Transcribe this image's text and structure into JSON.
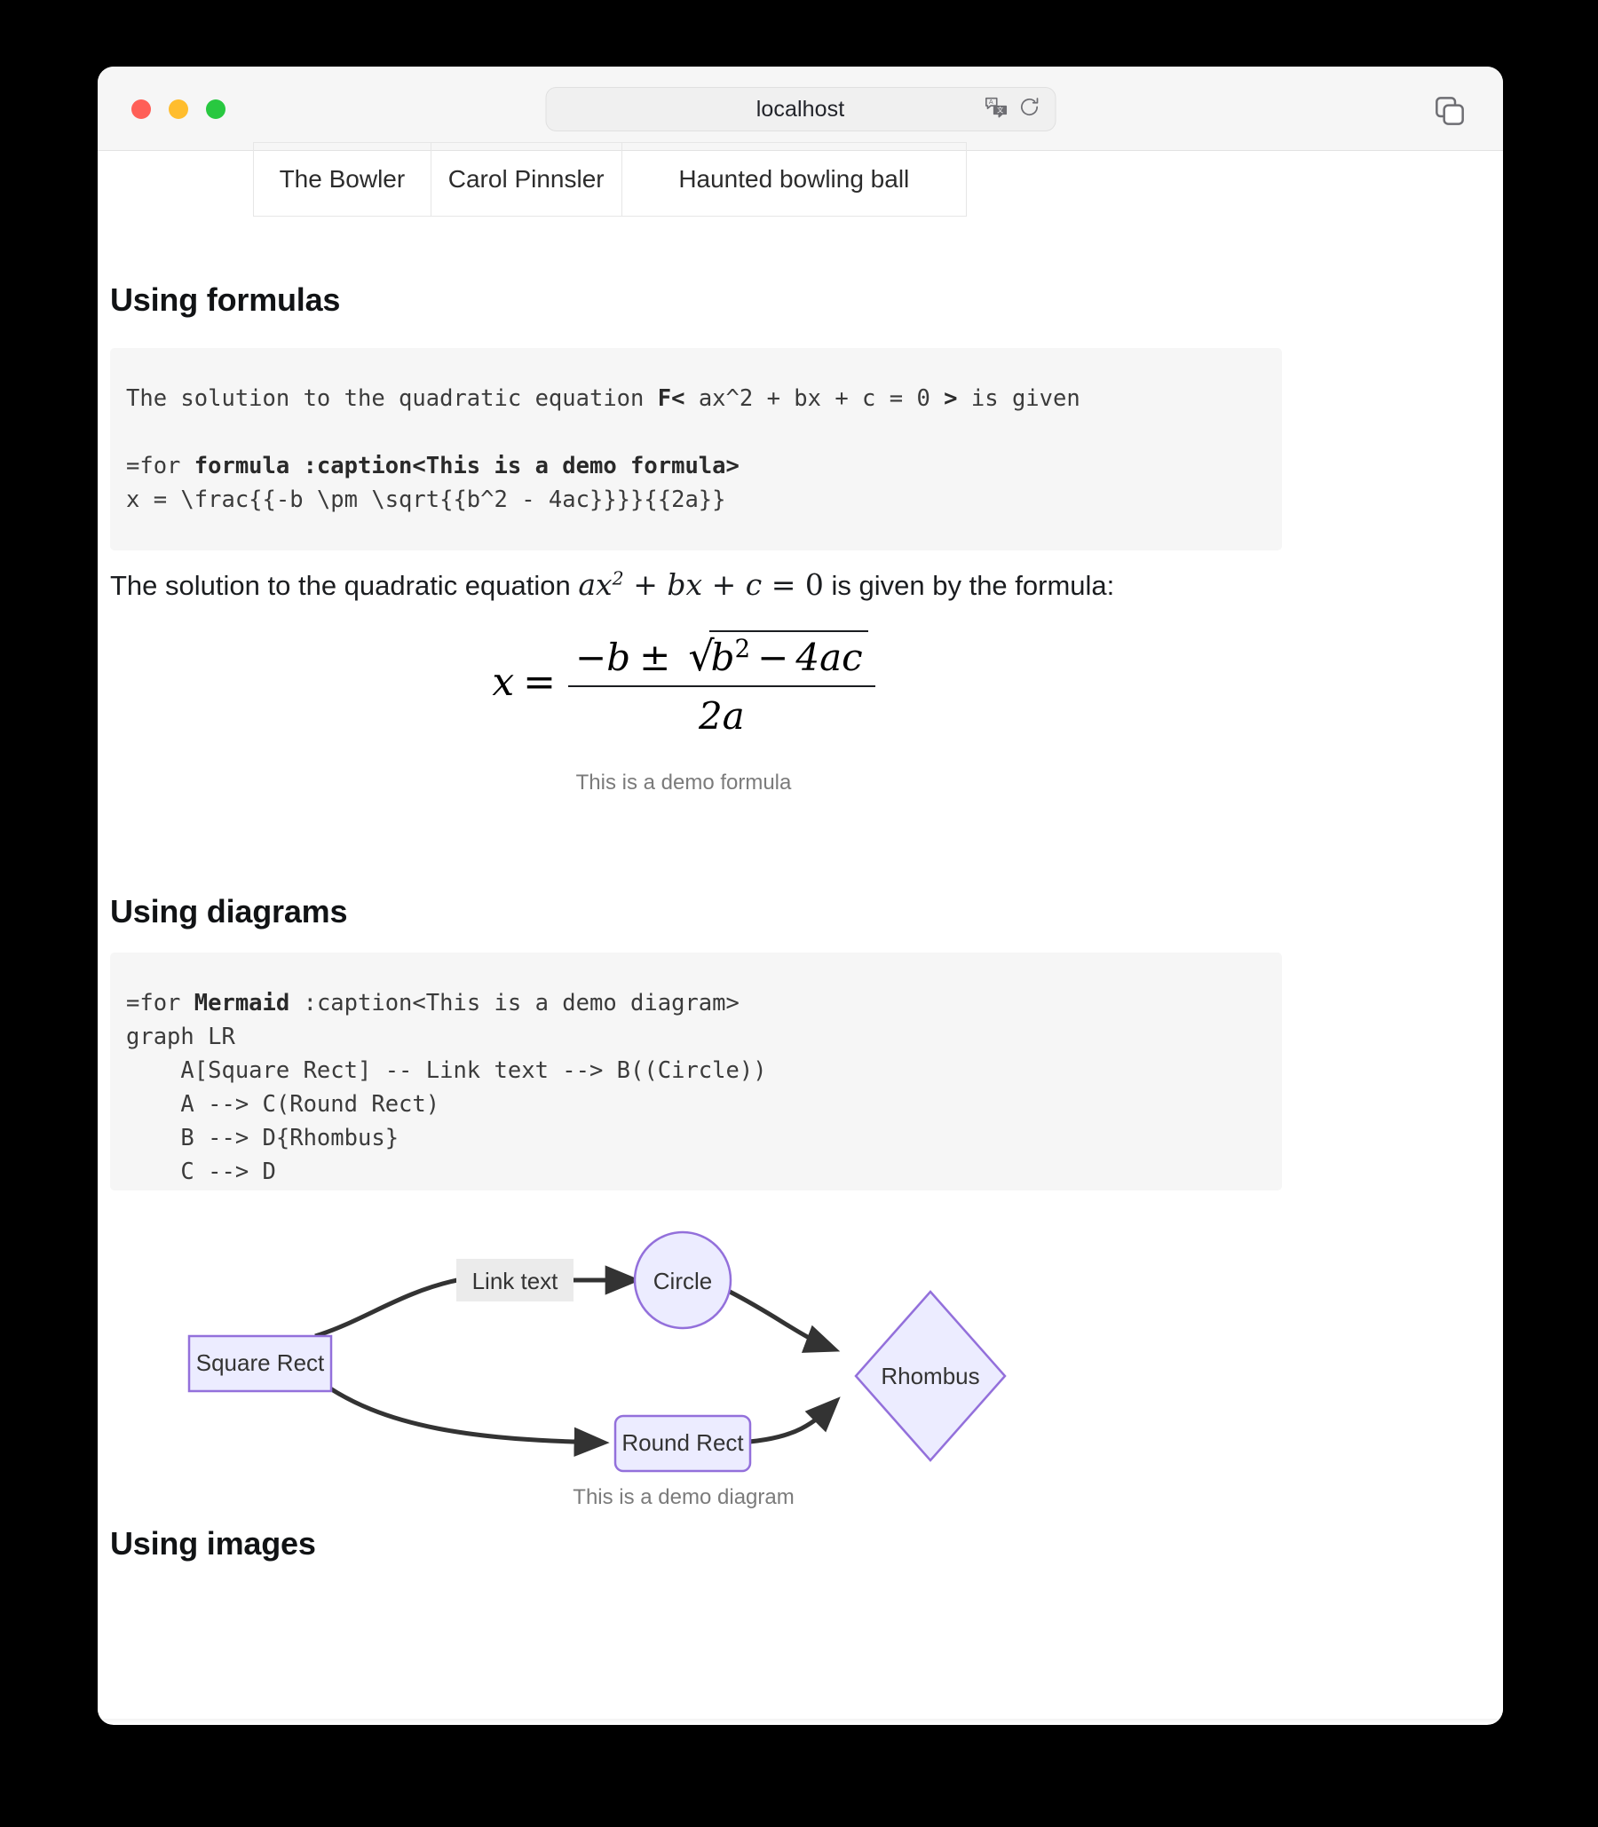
{
  "browser": {
    "url": "localhost",
    "traffic_lights": [
      "close",
      "minimize",
      "maximize"
    ],
    "icons": {
      "translate": "translate-icon",
      "reload": "reload-icon",
      "tabs_overview": "tabs-overview-icon"
    },
    "colors": {
      "close": "#ff5f57",
      "minimize": "#ffbd2e",
      "maximize": "#28c840",
      "titlebar_bg": "#f6f6f6",
      "address_bg": "#f0f0f0"
    }
  },
  "table": {
    "row": [
      "The Bowler",
      "Carol Pinnsler",
      "Haunted bowling ball"
    ]
  },
  "sections": {
    "formulas_heading": "Using formulas",
    "diagrams_heading": "Using diagrams",
    "images_heading": "Using images"
  },
  "formula_code": {
    "line1_a": "The solution to the quadratic equation ",
    "line1_b": "F<",
    "line1_c": " ax^2 + bx + c = 0 ",
    "line1_d": ">",
    "line1_e": " is given",
    "line2_a": "=for ",
    "line2_b": "formula :caption<This is a demo formula>",
    "line3": "x = \\frac{{-b \\pm \\sqrt{{b^2 - 4ac}}}}{{2a}}"
  },
  "formula_rendered": {
    "prefix": "The solution to the quadratic equation ",
    "inline_a": "ax",
    "inline_sup": "2",
    "inline_plus1": "+",
    "inline_b": "bx",
    "inline_plus2": "+",
    "inline_c": "c",
    "inline_eq": "=",
    "inline_zero": "0",
    "suffix": " is given by the formula:",
    "display": {
      "lhs": "x",
      "eq": "=",
      "num_minus_b": "−b",
      "num_pm": "±",
      "sqrt_glyph": "√",
      "sqrt_b": "b",
      "sqrt_b_sup": "2",
      "sqrt_minus": "−",
      "sqrt_4ac": "4ac",
      "den": "2a"
    },
    "caption": "This is a demo formula"
  },
  "mermaid_code": {
    "line1_a": "=for ",
    "line1_b": "Mermaid",
    "line1_c": " :caption<This is a demo diagram>",
    "line2": "graph LR",
    "line3": "    A[Square Rect] -- Link text --> B((Circle))",
    "line4": "    A --> C(Round Rect)",
    "line5": "    B --> D{Rhombus}",
    "line6": "    C --> D"
  },
  "diagram": {
    "caption": "This is a demo diagram",
    "nodes": {
      "square_rect": "Square Rect",
      "circle": "Circle",
      "round_rect": "Round Rect",
      "rhombus": "Rhombus"
    },
    "edge_label": "Link text",
    "colors": {
      "node_fill": "#ECECFF",
      "node_stroke": "#9370DB",
      "edge_stroke": "#333333",
      "label_bg": "#EBEBEB",
      "text": "#333333"
    }
  }
}
